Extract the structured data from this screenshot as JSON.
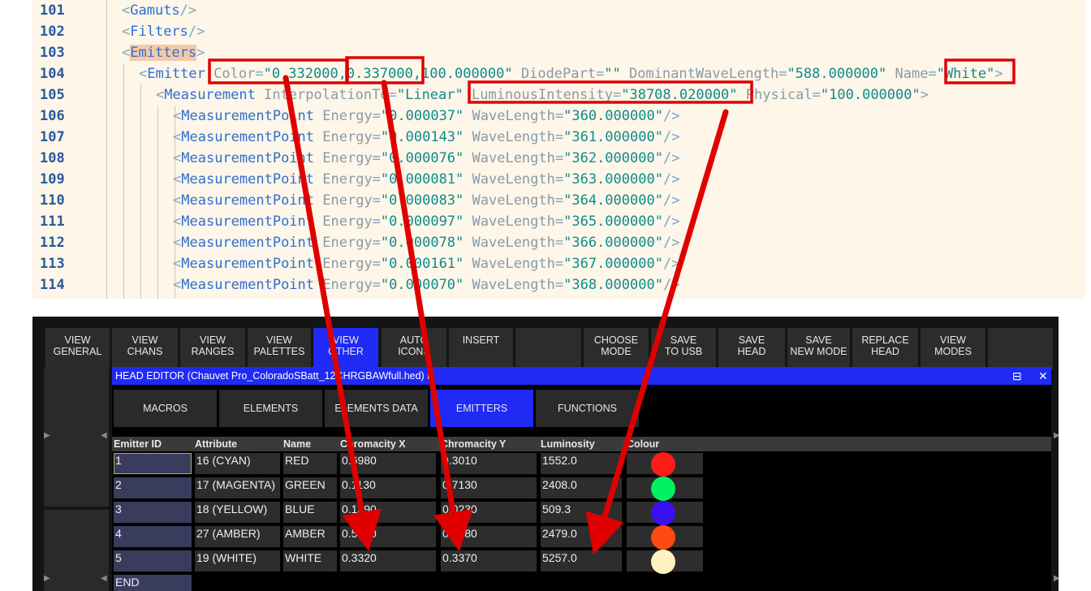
{
  "code": {
    "lines": [
      {
        "num": "101",
        "indent": 1,
        "parts": [
          {
            "c": "b",
            "t": "<"
          },
          {
            "c": "t",
            "t": "Gamuts"
          },
          {
            "c": "b",
            "t": "/>"
          }
        ]
      },
      {
        "num": "102",
        "indent": 1,
        "parts": [
          {
            "c": "b",
            "t": "<"
          },
          {
            "c": "t",
            "t": "Filters"
          },
          {
            "c": "b",
            "t": "/>"
          }
        ]
      },
      {
        "num": "103",
        "indent": 1,
        "parts": [
          {
            "c": "b",
            "t": "<"
          },
          {
            "c": "t hl",
            "t": "Emitters"
          },
          {
            "c": "b",
            "t": ">"
          }
        ]
      },
      {
        "num": "104",
        "indent": 2,
        "parts": [
          {
            "c": "b",
            "t": "<"
          },
          {
            "c": "t",
            "t": "Emitter"
          },
          {
            "c": "a",
            "t": " Color"
          },
          {
            "c": "e",
            "t": "="
          },
          {
            "c": "v",
            "t": "\"0.332000,0.337000,100.000000\""
          },
          {
            "c": "a",
            "t": " DiodePart"
          },
          {
            "c": "e",
            "t": "="
          },
          {
            "c": "v",
            "t": "\"\""
          },
          {
            "c": "a",
            "t": " DominantWaveLength"
          },
          {
            "c": "e",
            "t": "="
          },
          {
            "c": "v",
            "t": "\"588.000000\""
          },
          {
            "c": "a",
            "t": " Name"
          },
          {
            "c": "e",
            "t": "="
          },
          {
            "c": "v",
            "t": "\"White\""
          },
          {
            "c": "b",
            "t": ">"
          }
        ]
      },
      {
        "num": "105",
        "indent": 3,
        "parts": [
          {
            "c": "b",
            "t": "<"
          },
          {
            "c": "t",
            "t": "Measurement"
          },
          {
            "c": "a",
            "t": " InterpolationTo"
          },
          {
            "c": "e",
            "t": "="
          },
          {
            "c": "v",
            "t": "\"Linear\""
          },
          {
            "c": "a",
            "t": " LuminousIntensity"
          },
          {
            "c": "e",
            "t": "="
          },
          {
            "c": "v",
            "t": "\"38708.020000\""
          },
          {
            "c": "a",
            "t": " Physical"
          },
          {
            "c": "e",
            "t": "="
          },
          {
            "c": "v",
            "t": "\"100.000000\""
          },
          {
            "c": "b",
            "t": ">"
          }
        ]
      },
      {
        "num": "106",
        "indent": 4,
        "parts": [
          {
            "c": "b",
            "t": "<"
          },
          {
            "c": "t",
            "t": "MeasurementPoint"
          },
          {
            "c": "a",
            "t": " Energy"
          },
          {
            "c": "e",
            "t": "="
          },
          {
            "c": "v",
            "t": "\"0.000037\""
          },
          {
            "c": "a",
            "t": " WaveLength"
          },
          {
            "c": "e",
            "t": "="
          },
          {
            "c": "v",
            "t": "\"360.000000\""
          },
          {
            "c": "b",
            "t": "/>"
          }
        ]
      },
      {
        "num": "107",
        "indent": 4,
        "parts": [
          {
            "c": "b",
            "t": "<"
          },
          {
            "c": "t",
            "t": "MeasurementPoint"
          },
          {
            "c": "a",
            "t": " Energy"
          },
          {
            "c": "e",
            "t": "="
          },
          {
            "c": "v",
            "t": "\"0.000143\""
          },
          {
            "c": "a",
            "t": " WaveLength"
          },
          {
            "c": "e",
            "t": "="
          },
          {
            "c": "v",
            "t": "\"361.000000\""
          },
          {
            "c": "b",
            "t": "/>"
          }
        ]
      },
      {
        "num": "108",
        "indent": 4,
        "parts": [
          {
            "c": "b",
            "t": "<"
          },
          {
            "c": "t",
            "t": "MeasurementPoint"
          },
          {
            "c": "a",
            "t": " Energy"
          },
          {
            "c": "e",
            "t": "="
          },
          {
            "c": "v",
            "t": "\"0.000076\""
          },
          {
            "c": "a",
            "t": " WaveLength"
          },
          {
            "c": "e",
            "t": "="
          },
          {
            "c": "v",
            "t": "\"362.000000\""
          },
          {
            "c": "b",
            "t": "/>"
          }
        ]
      },
      {
        "num": "109",
        "indent": 4,
        "parts": [
          {
            "c": "b",
            "t": "<"
          },
          {
            "c": "t",
            "t": "MeasurementPoint"
          },
          {
            "c": "a",
            "t": " Energy"
          },
          {
            "c": "e",
            "t": "="
          },
          {
            "c": "v",
            "t": "\"0.000081\""
          },
          {
            "c": "a",
            "t": " WaveLength"
          },
          {
            "c": "e",
            "t": "="
          },
          {
            "c": "v",
            "t": "\"363.000000\""
          },
          {
            "c": "b",
            "t": "/>"
          }
        ]
      },
      {
        "num": "110",
        "indent": 4,
        "parts": [
          {
            "c": "b",
            "t": "<"
          },
          {
            "c": "t",
            "t": "MeasurementPoint"
          },
          {
            "c": "a",
            "t": " Energy"
          },
          {
            "c": "e",
            "t": "="
          },
          {
            "c": "v",
            "t": "\"0.000083\""
          },
          {
            "c": "a",
            "t": " WaveLength"
          },
          {
            "c": "e",
            "t": "="
          },
          {
            "c": "v",
            "t": "\"364.000000\""
          },
          {
            "c": "b",
            "t": "/>"
          }
        ]
      },
      {
        "num": "111",
        "indent": 4,
        "parts": [
          {
            "c": "b",
            "t": "<"
          },
          {
            "c": "t",
            "t": "MeasurementPoint"
          },
          {
            "c": "a",
            "t": " Energy"
          },
          {
            "c": "e",
            "t": "="
          },
          {
            "c": "v",
            "t": "\"0.000097\""
          },
          {
            "c": "a",
            "t": " WaveLength"
          },
          {
            "c": "e",
            "t": "="
          },
          {
            "c": "v",
            "t": "\"365.000000\""
          },
          {
            "c": "b",
            "t": "/>"
          }
        ]
      },
      {
        "num": "112",
        "indent": 4,
        "parts": [
          {
            "c": "b",
            "t": "<"
          },
          {
            "c": "t",
            "t": "MeasurementPoint"
          },
          {
            "c": "a",
            "t": " Energy"
          },
          {
            "c": "e",
            "t": "="
          },
          {
            "c": "v",
            "t": "\"0.000078\""
          },
          {
            "c": "a",
            "t": " WaveLength"
          },
          {
            "c": "e",
            "t": "="
          },
          {
            "c": "v",
            "t": "\"366.000000\""
          },
          {
            "c": "b",
            "t": "/>"
          }
        ]
      },
      {
        "num": "113",
        "indent": 4,
        "parts": [
          {
            "c": "b",
            "t": "<"
          },
          {
            "c": "t",
            "t": "MeasurementPoint"
          },
          {
            "c": "a",
            "t": " Energy"
          },
          {
            "c": "e",
            "t": "="
          },
          {
            "c": "v",
            "t": "\"0.000161\""
          },
          {
            "c": "a",
            "t": " WaveLength"
          },
          {
            "c": "e",
            "t": "="
          },
          {
            "c": "v",
            "t": "\"367.000000\""
          },
          {
            "c": "b",
            "t": "/>"
          }
        ]
      },
      {
        "num": "114",
        "indent": 4,
        "parts": [
          {
            "c": "b",
            "t": "<"
          },
          {
            "c": "t",
            "t": "MeasurementPoint"
          },
          {
            "c": "a",
            "t": " Energy"
          },
          {
            "c": "e",
            "t": "="
          },
          {
            "c": "v",
            "t": "\"0.000070\""
          },
          {
            "c": "a",
            "t": " WaveLength"
          },
          {
            "c": "e",
            "t": "="
          },
          {
            "c": "v",
            "t": "\"368.000000\""
          },
          {
            "c": "b",
            "t": "/>"
          }
        ]
      }
    ]
  },
  "toolbar": {
    "buttons": [
      {
        "label": "VIEW\nGENERAL",
        "active": false
      },
      {
        "label": "VIEW\nCHANS",
        "active": false
      },
      {
        "label": "VIEW\nRANGES",
        "active": false
      },
      {
        "label": "VIEW\nPALETTES",
        "active": false
      },
      {
        "label": "VIEW\nOTHER",
        "active": true
      },
      {
        "label": "AUTO\nICONS",
        "active": false
      },
      {
        "label": "INSERT",
        "active": false
      },
      {
        "label": "",
        "active": false
      },
      {
        "label": "CHOOSE\nMODE",
        "active": false
      },
      {
        "label": "SAVE\nTO USB",
        "active": false
      },
      {
        "label": "SAVE\nHEAD",
        "active": false
      },
      {
        "label": "SAVE\nNEW MODE",
        "active": false
      },
      {
        "label": "REPLACE\nHEAD",
        "active": false
      },
      {
        "label": "VIEW\nMODES",
        "active": false
      },
      {
        "label": "",
        "active": false
      }
    ]
  },
  "head_editor": {
    "title": "HEAD EDITOR (Chauvet Pro_ColoradoSBatt_12CHRGBAWfull.hed) L",
    "subtabs": [
      {
        "label": "MACROS",
        "active": false
      },
      {
        "label": "ELEMENTS",
        "active": false
      },
      {
        "label": "ELEMENTS DATA",
        "active": false
      },
      {
        "label": "EMITTERS",
        "active": true
      },
      {
        "label": "FUNCTIONS",
        "active": false
      }
    ],
    "columns": [
      "Emitter ID",
      "Attribute",
      "Name",
      "Chromacity X",
      "Chromacity Y",
      "Luminosity",
      "Colour"
    ],
    "rows": [
      {
        "id": "1",
        "attribute": "16 (CYAN)",
        "name": "RED",
        "x": "0.6980",
        "y": "0.3010",
        "lum": "1552.0",
        "colour": "#ff1a1a"
      },
      {
        "id": "2",
        "attribute": "17 (MAGENTA)",
        "name": "GREEN",
        "x": "0.1130",
        "y": "0.7130",
        "lum": "2408.0",
        "colour": "#00f060"
      },
      {
        "id": "3",
        "attribute": "18 (YELLOW)",
        "name": "BLUE",
        "x": "0.1590",
        "y": "0.0230",
        "lum": "509.3",
        "colour": "#3a10f0"
      },
      {
        "id": "4",
        "attribute": "27 (AMBER)",
        "name": "AMBER",
        "x": "0.5700",
        "y": "0.4180",
        "lum": "2479.0",
        "colour": "#ff4a12"
      },
      {
        "id": "5",
        "attribute": "19 (WHITE)",
        "name": "WHITE",
        "x": "0.3320",
        "y": "0.3370",
        "lum": "5257.0",
        "colour": "#fff2c0"
      }
    ],
    "end_label": "END"
  },
  "annotation_color": "#e00000"
}
